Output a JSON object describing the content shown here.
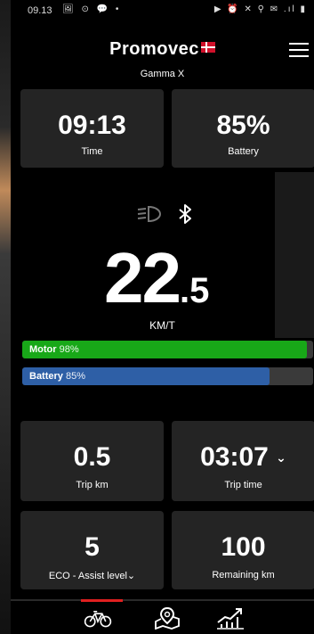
{
  "status_bar": {
    "time": "09.13",
    "left_icons": "🖼 ⊙ 💬 •",
    "right_icons": "▶ ⏰ ✕ ⚲ ✉ .ıl ▮"
  },
  "header": {
    "brand": "Promovec",
    "model": "Gamma X"
  },
  "top_cards": [
    {
      "value": "09:13",
      "label": "Time"
    },
    {
      "value": "85%",
      "label": "Battery"
    }
  ],
  "speed": {
    "integer": "22",
    "decimal": ".5",
    "unit": "KM/T"
  },
  "icons": {
    "light": "headlight-icon",
    "bluetooth": "bluetooth-icon"
  },
  "bars": {
    "motor": {
      "label": "Motor",
      "value_text": "98%",
      "level": 0.98,
      "color": "#18a818"
    },
    "battery": {
      "label": "Battery",
      "value_text": "85%",
      "level": 0.85,
      "color": "#2e5fa6"
    }
  },
  "bottom_cards": [
    {
      "value": "0.5",
      "label": "Trip km"
    },
    {
      "value": "03:07",
      "label": "Trip time",
      "chevron": "⌄"
    },
    {
      "value": "5",
      "label": "ECO - Assist level",
      "chevron": "⌄"
    },
    {
      "value": "100",
      "label": "Remaining km"
    }
  ],
  "nav": {
    "items": [
      "bike-icon",
      "map-icon",
      "stats-icon"
    ],
    "active": 0,
    "accent": "#e02020"
  }
}
